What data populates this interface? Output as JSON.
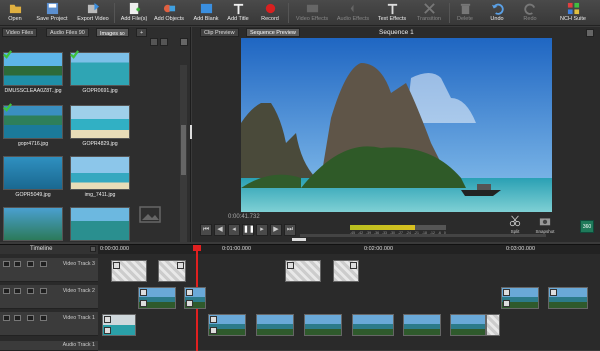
{
  "toolbar": {
    "open": "Open",
    "save_project": "Save Project",
    "export_video": "Export Video",
    "add_files": "Add File(s)",
    "add_objects": "Add Objects",
    "add_blank": "Add Blank",
    "add_title": "Add Title",
    "record": "Record",
    "video_effects": "Video Effects",
    "audio_effects": "Audio Effects",
    "text_effects": "Text Effects",
    "transition": "Transition",
    "delete": "Delete",
    "undo": "Undo",
    "redo": "Redo",
    "suite": "NCH Suite"
  },
  "media_tabs": {
    "video": "Video Files",
    "audio": "Audio Files",
    "audio_count": "90",
    "images": "Images",
    "images_count": "50",
    "add": "+"
  },
  "media_items": [
    {
      "name": "DMUSSCLEAA0Z8T..jpg",
      "checked": true
    },
    {
      "name": "GOPR0691.jpg",
      "checked": true
    },
    {
      "name": "gopr4716.jpg",
      "checked": true
    },
    {
      "name": "GOPR4829.jpg",
      "checked": false
    },
    {
      "name": "GOPR5049.jpg",
      "checked": false
    },
    {
      "name": "img_7411.jpg",
      "checked": false
    },
    {
      "name": "",
      "checked": false
    },
    {
      "name": "",
      "checked": false
    }
  ],
  "preview_tabs": {
    "clip": "Clip Preview",
    "sequence": "Sequence Preview"
  },
  "sequence_title": "Sequence 1",
  "playback": {
    "timecode": "0:00:41.732",
    "meter_ticks": [
      "-45",
      "-42",
      "-39",
      "-36",
      "-33",
      "-30",
      "-27",
      "-24",
      "-21",
      "-18",
      "-12",
      "-6",
      "0"
    ],
    "split": "Split",
    "snapshot": "Snapshot",
    "three_sixty": "360"
  },
  "timeline": {
    "label": "Timeline",
    "ruler": [
      "0:00:00.000",
      "0:01:00.000",
      "0:02:00.000",
      "0:03:00.000"
    ],
    "tracks": [
      "Video Track 3",
      "Video Track 2",
      "Video Track 1",
      "Audio Track 1"
    ]
  },
  "colors": {
    "accent": "#3e86c8",
    "playhead": "#e02020",
    "check": "#3ec23e"
  }
}
